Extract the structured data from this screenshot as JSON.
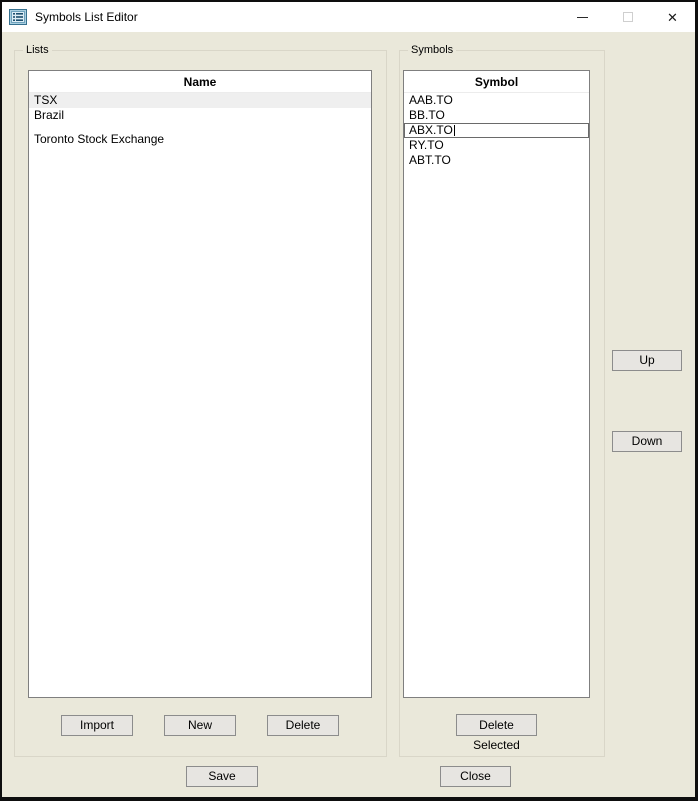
{
  "window": {
    "title": "Symbols List Editor",
    "icons": {
      "app": "list-icon",
      "minimize": "—",
      "maximize": "□",
      "close": "✕"
    }
  },
  "lists": {
    "label": "Lists",
    "header": "Name",
    "rows": [
      "TSX",
      "Brazil",
      "Toronto Stock Exchange"
    ],
    "selected_row": "TSX",
    "buttons": {
      "import": "Import",
      "new": "New",
      "delete": "Delete"
    }
  },
  "symbols": {
    "label": "Symbols",
    "header": "Symbol",
    "rows": [
      "AAB.TO",
      "BB.TO",
      "ABX.TO",
      "RY.TO",
      "ABT.TO"
    ],
    "editing_symbol": "ABX.TO",
    "buttons": {
      "delete_selected": "Delete Selected"
    }
  },
  "side_buttons": {
    "up": "Up",
    "down": "Down"
  },
  "footer": {
    "save": "Save",
    "close": "Close"
  },
  "colors": {
    "body_bg": "#eae8da",
    "titlebar_bg": "#ffffff",
    "selected_row_bg": "#efefef",
    "button_bg": "#e7e5e1",
    "button_border": "#8c8c8c",
    "table_border": "#7f7f7f",
    "groupbox_border": "#d9d6c8",
    "icon_blue": "#4e87a8"
  }
}
